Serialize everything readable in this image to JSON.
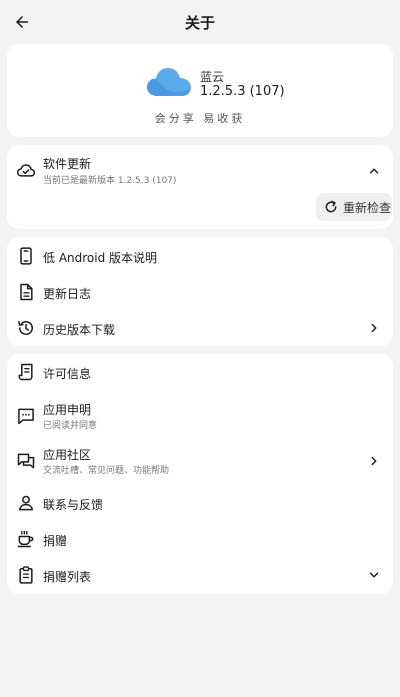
{
  "header": {
    "title": "关于"
  },
  "app": {
    "name": "蓝云",
    "version": "1.2.5.3 (107)",
    "slogan": "会分享 易收获",
    "accent": "#5aa9ea"
  },
  "update": {
    "title": "软件更新",
    "subtitle": "当前已是最新版本 1.2.5.3 (107)",
    "recheck_label": "重新检查"
  },
  "history": {
    "items": [
      {
        "label": "低 Android 版本说明",
        "icon": "phone-icon"
      },
      {
        "label": "更新日志",
        "icon": "document-icon"
      },
      {
        "label": "历史版本下载",
        "icon": "history-icon"
      }
    ]
  },
  "info": {
    "items": [
      {
        "label": "许可信息",
        "icon": "license-icon"
      },
      {
        "label": "应用申明",
        "sub": "已阅读并同意",
        "icon": "statement-icon"
      },
      {
        "label": "应用社区",
        "sub": "交流吐槽、常见问题、功能帮助",
        "icon": "community-icon"
      },
      {
        "label": "联系与反馈",
        "icon": "person-icon"
      },
      {
        "label": "捐赠",
        "icon": "coffee-icon"
      },
      {
        "label": "捐赠列表",
        "icon": "clipboard-icon"
      }
    ]
  }
}
